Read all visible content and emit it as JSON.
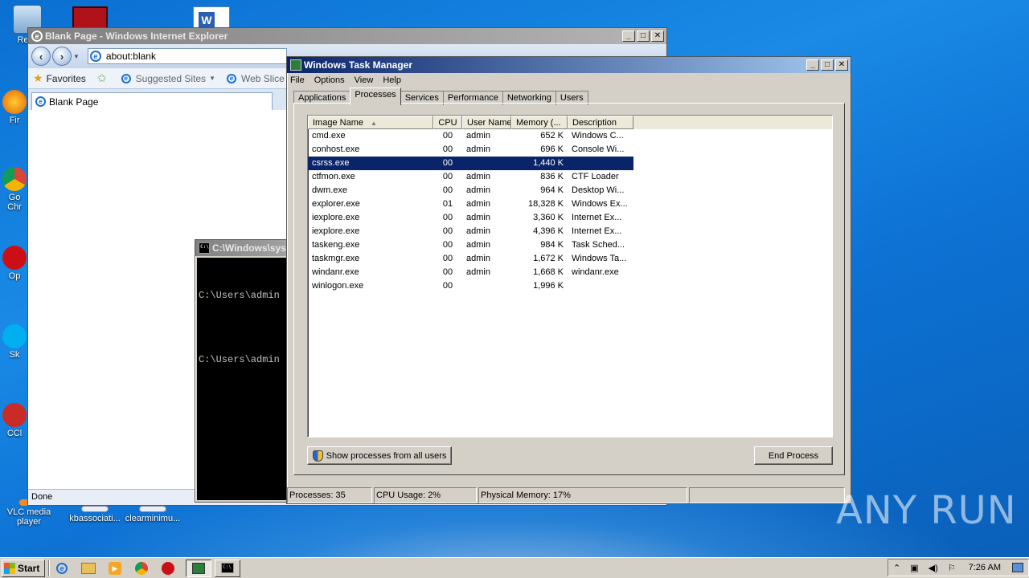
{
  "desktop": {
    "icons": [
      {
        "label": "Recy",
        "icon": "recycle-bin-icon"
      },
      {
        "label": "Fir",
        "icon": "firefox-icon"
      },
      {
        "label": "Go",
        "label2": "Chr",
        "icon": "chrome-icon"
      },
      {
        "label": "Op",
        "icon": "opera-icon"
      },
      {
        "label": "Sk",
        "icon": "skype-icon"
      },
      {
        "label": "CCl",
        "icon": "ccleaner-icon"
      },
      {
        "label": "VLC media",
        "label2": "player",
        "icon": "vlc-icon"
      },
      {
        "label": "kbassociati...",
        "icon": "document-icon"
      },
      {
        "label": "clearminimu...",
        "icon": "document-icon"
      }
    ]
  },
  "ie": {
    "title": "Blank Page - Windows Internet Explorer",
    "address": "about:blank",
    "favorites_label": "Favorites",
    "suggested_sites": "Suggested Sites",
    "web_slice": "Web Slice Galle",
    "tab_label": "Blank Page",
    "status": "Done"
  },
  "cmd": {
    "title": "C:\\Windows\\sys",
    "line1": "C:\\Users\\admin",
    "line2": "C:\\Users\\admin"
  },
  "taskmgr": {
    "title": "Windows Task Manager",
    "menu": [
      "File",
      "Options",
      "View",
      "Help"
    ],
    "tabs": [
      "Applications",
      "Processes",
      "Services",
      "Performance",
      "Networking",
      "Users"
    ],
    "selected_tab": "Processes",
    "columns": [
      "Image Name",
      "CPU",
      "User Name",
      "Memory (...",
      "Description"
    ],
    "rows": [
      {
        "name": "cmd.exe",
        "cpu": "00",
        "user": "admin",
        "mem": "652 K",
        "desc": "Windows C..."
      },
      {
        "name": "conhost.exe",
        "cpu": "00",
        "user": "admin",
        "mem": "696 K",
        "desc": "Console Wi..."
      },
      {
        "name": "csrss.exe",
        "cpu": "00",
        "user": "",
        "mem": "1,440 K",
        "desc": ""
      },
      {
        "name": "ctfmon.exe",
        "cpu": "00",
        "user": "admin",
        "mem": "836 K",
        "desc": "CTF Loader"
      },
      {
        "name": "dwm.exe",
        "cpu": "00",
        "user": "admin",
        "mem": "964 K",
        "desc": "Desktop Wi..."
      },
      {
        "name": "explorer.exe",
        "cpu": "01",
        "user": "admin",
        "mem": "18,328 K",
        "desc": "Windows Ex..."
      },
      {
        "name": "iexplore.exe",
        "cpu": "00",
        "user": "admin",
        "mem": "3,360 K",
        "desc": "Internet Ex..."
      },
      {
        "name": "iexplore.exe",
        "cpu": "00",
        "user": "admin",
        "mem": "4,396 K",
        "desc": "Internet Ex..."
      },
      {
        "name": "taskeng.exe",
        "cpu": "00",
        "user": "admin",
        "mem": "984 K",
        "desc": "Task Sched..."
      },
      {
        "name": "taskmgr.exe",
        "cpu": "00",
        "user": "admin",
        "mem": "1,672 K",
        "desc": "Windows Ta..."
      },
      {
        "name": "windanr.exe",
        "cpu": "00",
        "user": "admin",
        "mem": "1,668 K",
        "desc": "windanr.exe"
      },
      {
        "name": "winlogon.exe",
        "cpu": "00",
        "user": "",
        "mem": "1,996 K",
        "desc": ""
      }
    ],
    "selected_row": 2,
    "show_all_label": "Show processes from all users",
    "end_process_label": "End Process",
    "status": {
      "processes": "Processes: 35",
      "cpu": "CPU Usage: 2%",
      "memory": "Physical Memory: 17%"
    }
  },
  "taskbar": {
    "start_label": "Start",
    "clock": "7:26 AM"
  },
  "watermark": "ANY RUN",
  "colors": {
    "selection": "#0a246a",
    "desktop": "#0d72d4"
  }
}
